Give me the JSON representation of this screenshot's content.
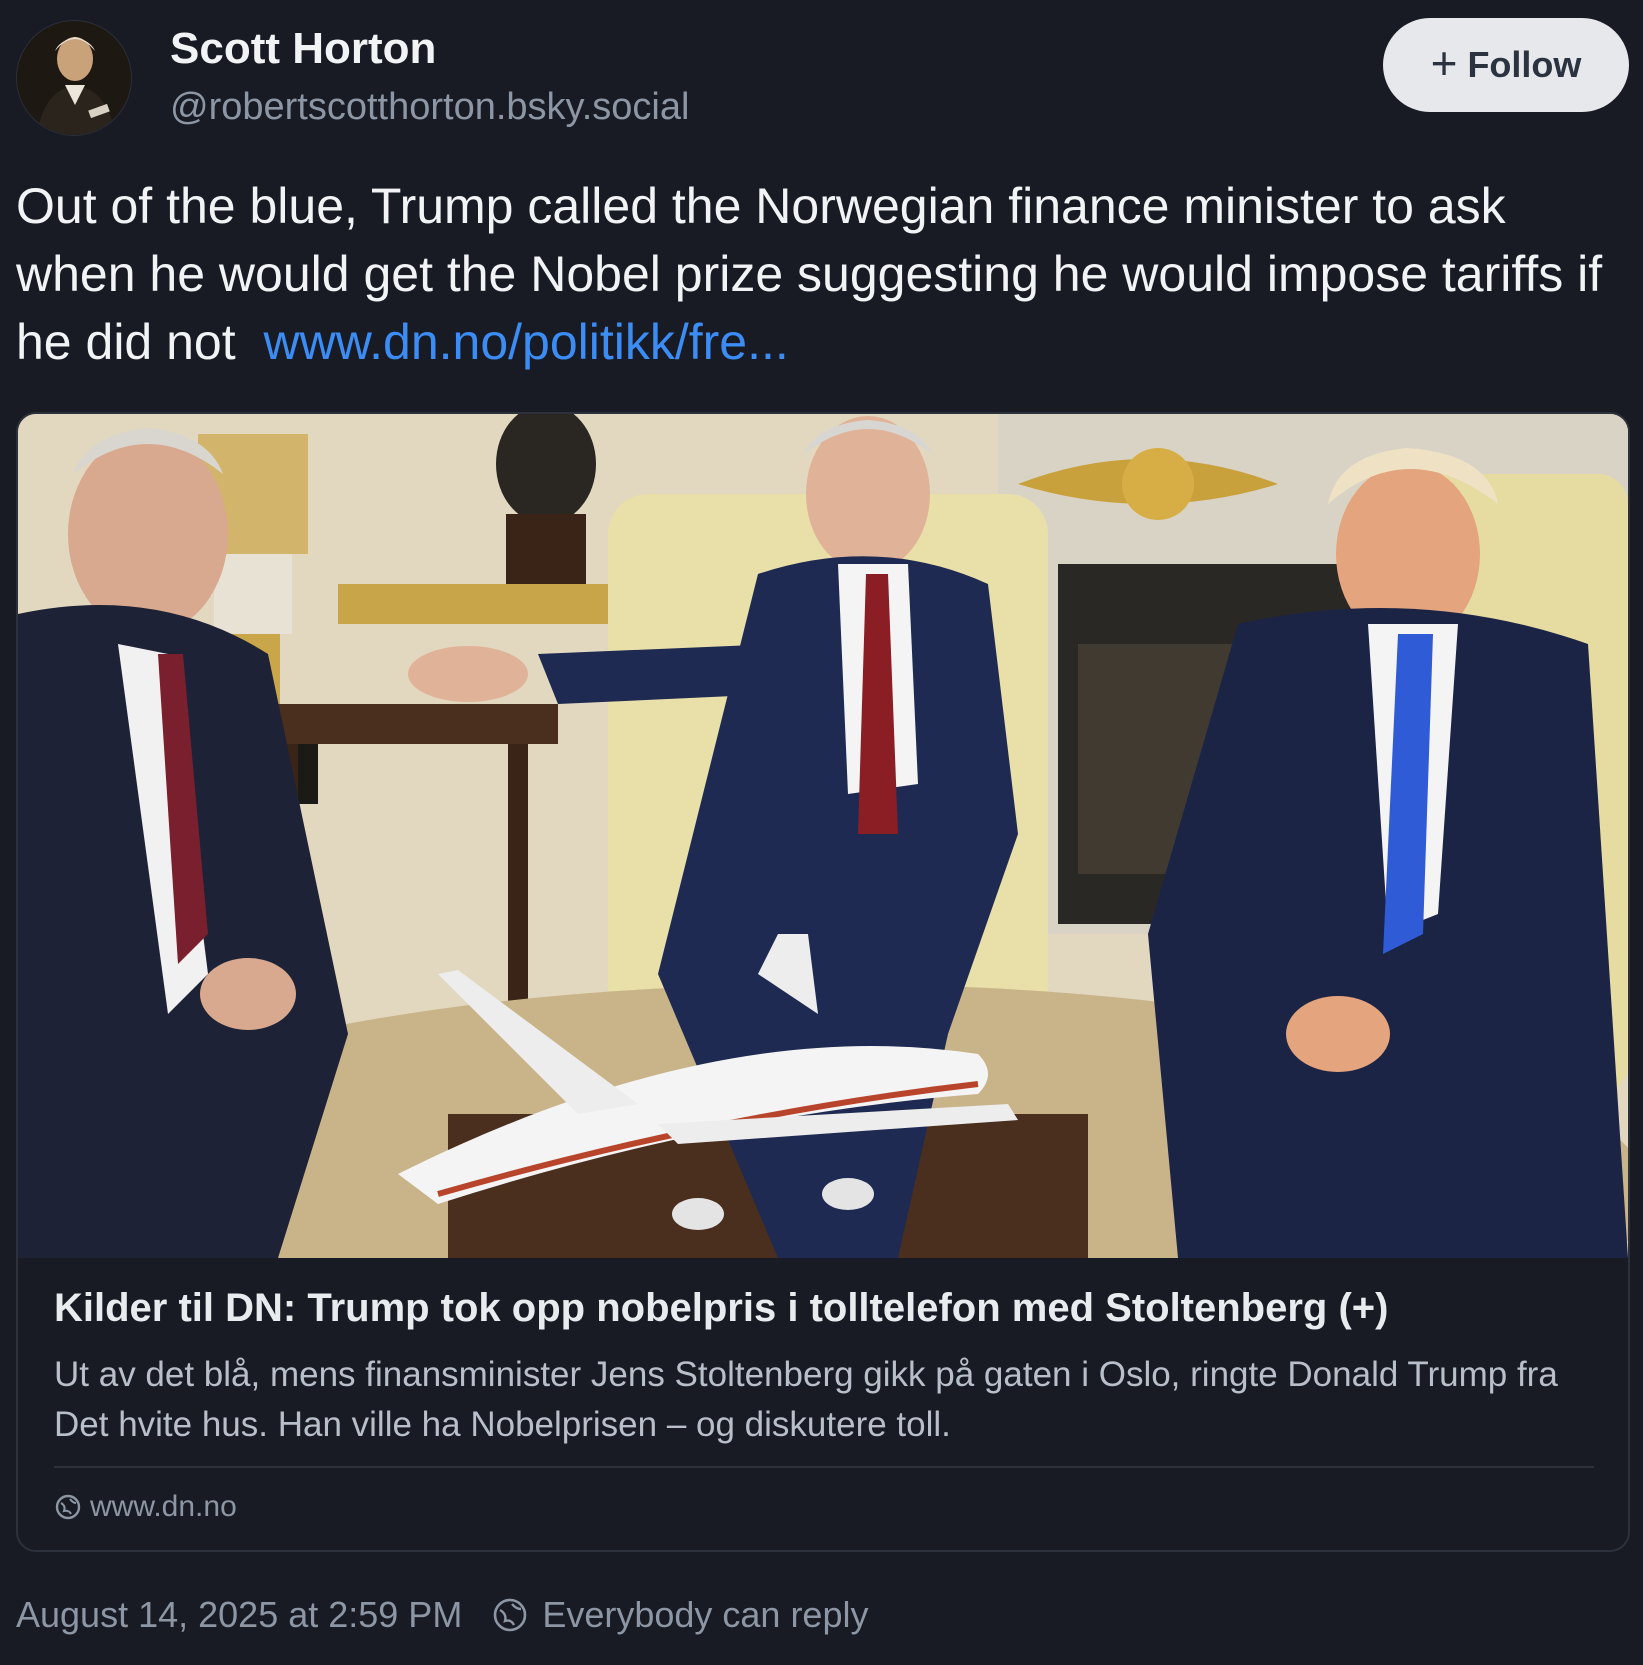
{
  "author": {
    "display_name": "Scott Horton",
    "handle": "@robertscotthorton.bsky.social",
    "avatar_icon": "portrait-avatar"
  },
  "follow_button": {
    "icon": "plus-icon",
    "icon_glyph": "+",
    "label": "Follow"
  },
  "post": {
    "text": "Out of the blue, Trump called the Norwegian finance minister to ask when he would get the Nobel prize suggesting he would impose tariffs if he did not",
    "link_text": "www.dn.no/politikk/fre..."
  },
  "link_card": {
    "image_icon": "news-photo-image",
    "title": "Kilder til DN: Trump tok opp nobelpris i tolltelefon med Stoltenberg (+)",
    "description": "Ut av det blå, mens finansminister Jens Stoltenberg gikk på gaten i Oslo, ringte Donald Trump fra Det hvite hus. Han ville ha Nobelprisen – og diskutere toll.",
    "domain": "www.dn.no",
    "domain_icon": "globe-icon"
  },
  "footer": {
    "timestamp": "August 14, 2025 at 2:59 PM",
    "reply_icon": "globe-icon",
    "reply_setting": "Everybody can reply"
  },
  "colors": {
    "background": "#181b24",
    "link": "#3b8cf5",
    "muted_text": "#8d96a4",
    "follow_button_bg": "#e6e8ec"
  }
}
